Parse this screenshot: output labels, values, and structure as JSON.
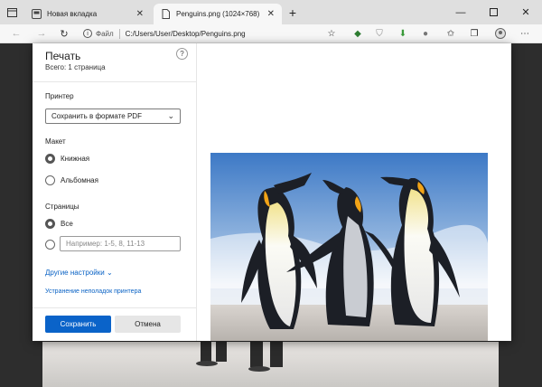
{
  "browser": {
    "tabs": [
      {
        "title": "Новая вкладка"
      },
      {
        "title": "Penguins.png (1024×768)"
      }
    ],
    "address": {
      "scheme_label": "Файл",
      "url": "C:/Users/User/Desktop/Penguins.png"
    }
  },
  "print": {
    "title": "Печать",
    "total": "Всего: 1 страница",
    "printer_heading": "Принтер",
    "printer_value": "Сохранить в формате PDF",
    "layout_heading": "Макет",
    "layout_portrait": "Книжная",
    "layout_landscape": "Альбомная",
    "pages_heading": "Страницы",
    "pages_all": "Все",
    "pages_placeholder": "Например: 1-5, 8, 11-13",
    "more_settings": "Другие настройки",
    "troubleshoot": "Устранение неполадок принтера",
    "save_button": "Сохранить",
    "cancel_button": "Отмена"
  },
  "colors": {
    "accent": "#0a63c9",
    "link": "#0b63c5"
  }
}
